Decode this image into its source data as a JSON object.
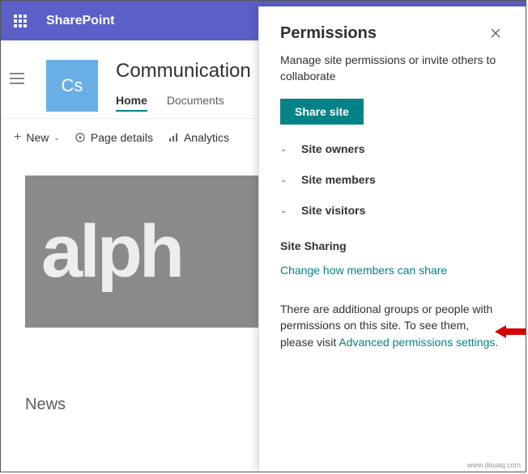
{
  "app": {
    "brand": "SharePoint"
  },
  "site": {
    "logo_initials": "Cs",
    "title": "Communication",
    "tabs": [
      {
        "label": "Home",
        "active": true
      },
      {
        "label": "Documents",
        "active": false
      }
    ]
  },
  "toolbar": {
    "new_label": "New",
    "page_details_label": "Page details",
    "analytics_label": "Analytics"
  },
  "banner": {
    "text": "alph"
  },
  "news": {
    "heading": "News"
  },
  "panel": {
    "title": "Permissions",
    "subtitle": "Manage site permissions or invite others to collaborate",
    "share_button": "Share site",
    "groups": [
      {
        "label": "Site owners"
      },
      {
        "label": "Site members"
      },
      {
        "label": "Site visitors"
      }
    ],
    "sharing_heading": "Site Sharing",
    "sharing_link": "Change how members can share",
    "advanced_prefix": "There are additional groups or people with permissions on this site. To see them, please visit ",
    "advanced_link": "Advanced permissions settings",
    "advanced_suffix": "."
  },
  "watermark": "www.deuaq.com"
}
